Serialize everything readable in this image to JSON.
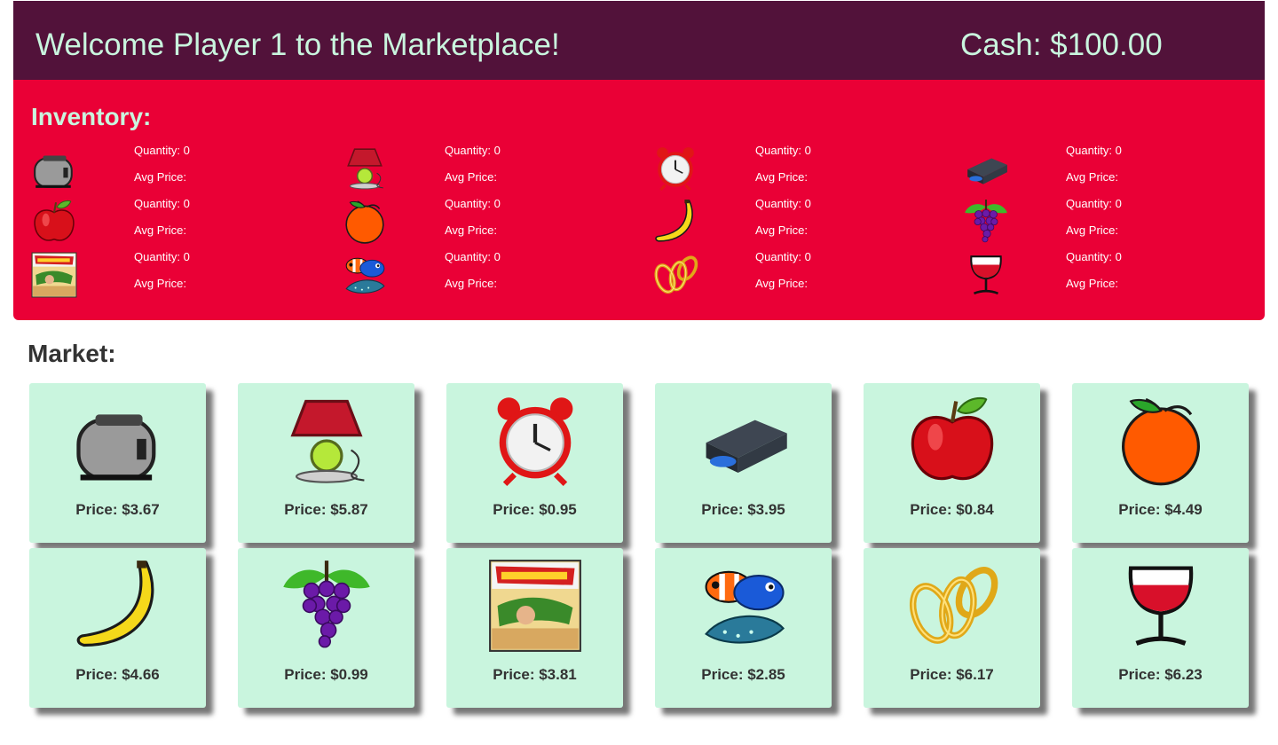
{
  "header": {
    "welcome": "Welcome Player 1 to the Marketplace!",
    "cash": "Cash: $100.00"
  },
  "inventory": {
    "title": "Inventory:",
    "items": [
      {
        "icon": "toaster-icon",
        "quantity": "Quantity: 0",
        "avg": "Avg Price:"
      },
      {
        "icon": "lamp-icon",
        "quantity": "Quantity: 0",
        "avg": "Avg Price:"
      },
      {
        "icon": "alarm-clock-icon",
        "quantity": "Quantity: 0",
        "avg": "Avg Price:"
      },
      {
        "icon": "bluray-player-icon",
        "quantity": "Quantity: 0",
        "avg": "Avg Price:"
      },
      {
        "icon": "apple-icon",
        "quantity": "Quantity: 0",
        "avg": "Avg Price:"
      },
      {
        "icon": "orange-icon",
        "quantity": "Quantity: 0",
        "avg": "Avg Price:"
      },
      {
        "icon": "banana-icon",
        "quantity": "Quantity: 0",
        "avg": "Avg Price:"
      },
      {
        "icon": "grapes-icon",
        "quantity": "Quantity: 0",
        "avg": "Avg Price:"
      },
      {
        "icon": "comic-book-icon",
        "quantity": "Quantity: 0",
        "avg": "Avg Price:"
      },
      {
        "icon": "fish-icon",
        "quantity": "Quantity: 0",
        "avg": "Avg Price:"
      },
      {
        "icon": "gold-rings-icon",
        "quantity": "Quantity: 0",
        "avg": "Avg Price:"
      },
      {
        "icon": "wine-glass-icon",
        "quantity": "Quantity: 0",
        "avg": "Avg Price:"
      }
    ]
  },
  "market": {
    "title": "Market:",
    "items": [
      {
        "icon": "toaster-icon",
        "price": "Price: $3.67"
      },
      {
        "icon": "lamp-icon",
        "price": "Price: $5.87"
      },
      {
        "icon": "alarm-clock-icon",
        "price": "Price: $0.95"
      },
      {
        "icon": "bluray-player-icon",
        "price": "Price: $3.95"
      },
      {
        "icon": "apple-icon",
        "price": "Price: $0.84"
      },
      {
        "icon": "orange-icon",
        "price": "Price: $4.49"
      },
      {
        "icon": "banana-icon",
        "price": "Price: $4.66"
      },
      {
        "icon": "grapes-icon",
        "price": "Price: $0.99"
      },
      {
        "icon": "comic-book-icon",
        "price": "Price: $3.81"
      },
      {
        "icon": "fish-icon",
        "price": "Price: $2.85"
      },
      {
        "icon": "gold-rings-icon",
        "price": "Price: $6.17"
      },
      {
        "icon": "wine-glass-icon",
        "price": "Price: $6.23"
      }
    ]
  },
  "colors": {
    "header_bg": "#52123a",
    "header_text": "#c9f5de",
    "inventory_bg": "#ea0036",
    "card_bg": "#c9f5de"
  }
}
